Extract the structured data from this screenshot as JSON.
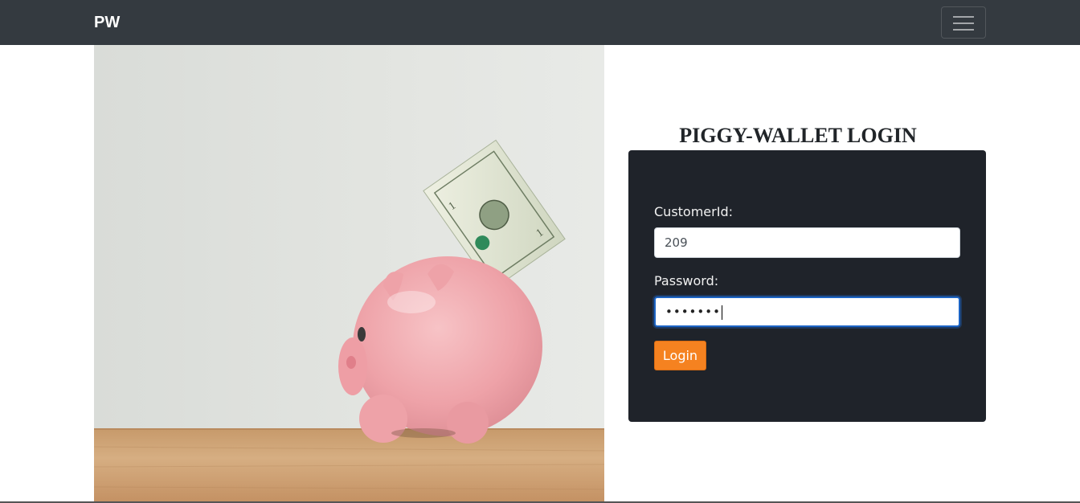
{
  "navbar": {
    "brand": "PW",
    "toggler_icon": "hamburger-menu-icon"
  },
  "hero": {
    "image_alt": "pink piggy bank with dollar bill"
  },
  "login": {
    "title": "PIGGY-WALLET LOGIN",
    "customer_id_label": "CustomerId:",
    "customer_id_value": "209",
    "password_label": "Password:",
    "password_value": "•••••••",
    "login_button": "Login"
  },
  "colors": {
    "navbar_bg": "#343a40",
    "card_bg": "#1f232a",
    "button_bg": "#f58220",
    "focus_border": "#1c64c4"
  }
}
